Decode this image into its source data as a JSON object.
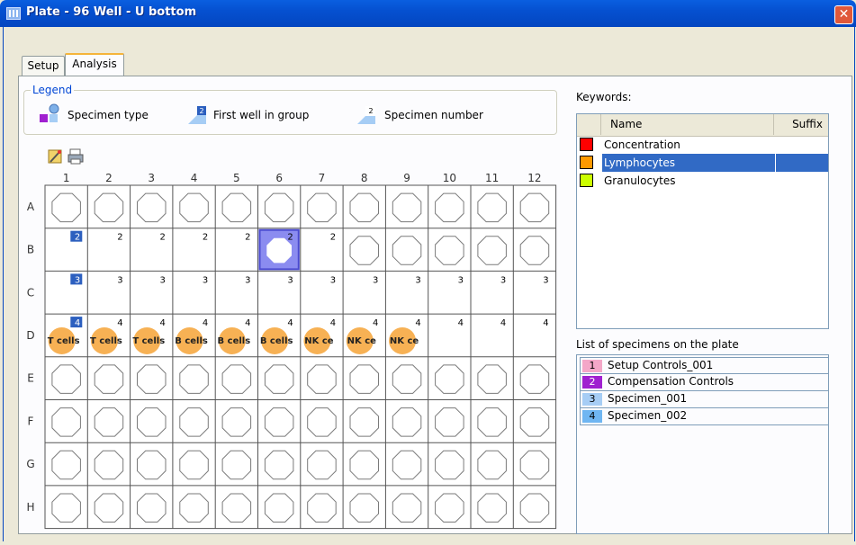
{
  "window": {
    "title": "Plate - 96 Well - U bottom",
    "close_glyph": "✕"
  },
  "tabs": [
    {
      "label": "Setup",
      "active": false
    },
    {
      "label": "Analysis",
      "active": true
    }
  ],
  "legend": {
    "title": "Legend",
    "items": [
      {
        "icon": "specimen-type-icon",
        "label": "Specimen type"
      },
      {
        "icon": "first-well-icon",
        "icon_text": "2",
        "label": "First well in group"
      },
      {
        "icon": "specimen-number-icon",
        "icon_text": "2",
        "label": "Specimen number"
      }
    ]
  },
  "toolbar": [
    {
      "icon": "edit-wand-icon"
    },
    {
      "icon": "print-icon"
    }
  ],
  "plate": {
    "columns": [
      "1",
      "2",
      "3",
      "4",
      "5",
      "6",
      "7",
      "8",
      "9",
      "10",
      "11",
      "12"
    ],
    "rows": [
      "A",
      "B",
      "C",
      "D",
      "E",
      "F",
      "G",
      "H"
    ],
    "row_numbers": {
      "B": [
        2,
        2,
        2,
        2,
        2,
        2,
        2,
        null,
        null,
        null,
        null,
        null
      ],
      "C": [
        3,
        3,
        3,
        3,
        3,
        3,
        3,
        3,
        3,
        3,
        3,
        3
      ],
      "D": [
        4,
        4,
        4,
        4,
        4,
        4,
        4,
        4,
        4,
        4,
        4,
        4
      ]
    },
    "first_well": {
      "B": 1,
      "C": 1,
      "D": 1
    },
    "labeled_wells": {
      "D": [
        "T cells",
        "T cells",
        "T cells",
        "B cells",
        "B cells",
        "B cells",
        "NK ce",
        "NK ce",
        "NK ce"
      ]
    },
    "selected_well": "B6",
    "colors": {
      "label_fill": "#f7b154",
      "first_well": "#2c5fbf",
      "selected": "#8b8cf0"
    }
  },
  "keywords": {
    "label": "Keywords:",
    "columns": [
      "Name",
      "Suffix"
    ],
    "rows": [
      {
        "name": "Concentration",
        "color": "#ff0000",
        "suffix": "",
        "selected": false
      },
      {
        "name": "Lymphocytes",
        "color": "#ff9900",
        "suffix": "",
        "selected": true
      },
      {
        "name": "Granulocytes",
        "color": "#ccff00",
        "suffix": "",
        "selected": false
      }
    ]
  },
  "specimens": {
    "label": "List of specimens on the plate",
    "items": [
      {
        "num": "1",
        "name": "Setup Controls_001",
        "color": "#f4a7c8",
        "text_color": "#000"
      },
      {
        "num": "2",
        "name": "Compensation Controls",
        "color": "#a020d0",
        "text_color": "#fff"
      },
      {
        "num": "3",
        "name": "Specimen_001",
        "color": "#a6cdf5",
        "text_color": "#000"
      },
      {
        "num": "4",
        "name": "Specimen_002",
        "color": "#6fb6f2",
        "text_color": "#000"
      }
    ]
  }
}
